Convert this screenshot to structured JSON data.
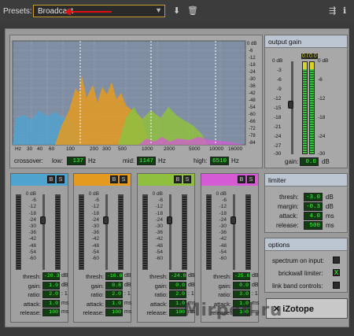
{
  "toolbar": {
    "presets_label": "Presets:",
    "preset_value": "Broadcast",
    "save_icon": "save-icon",
    "delete_icon": "trash-icon",
    "route_icon": "routing-icon",
    "info_icon": "info-icon"
  },
  "spectrum": {
    "freq_labels": [
      "Hz",
      "30",
      "40",
      "60",
      "100",
      "200",
      "300",
      "500",
      "1000",
      "2000",
      "5000",
      "10000",
      "16000"
    ],
    "db_labels": [
      "0 dB",
      "-6",
      "-12",
      "-18",
      "-24",
      "-30",
      "-36",
      "-42",
      "-48",
      "-54",
      "-60",
      "-66",
      "-72",
      "-78",
      "-84"
    ],
    "crossover_label": "crossover:",
    "low_label": "low:",
    "low_value": "137",
    "mid_label": "mid:",
    "mid_value": "1147",
    "high_label": "high:",
    "high_value": "6510",
    "hz_unit": "Hz"
  },
  "band_scale": [
    "0 dB",
    "-6",
    "-12",
    "-18",
    "-24",
    "-30",
    "-36",
    "-42",
    "-48",
    "-54",
    "-60"
  ],
  "bands": [
    {
      "color": "#4fa3cf",
      "thresh": "-20.3",
      "gain": "1.0",
      "ratio": "2.0",
      "attack": "1.0",
      "release": "100"
    },
    {
      "color": "#e49a1f",
      "thresh": "-16.6",
      "gain": "0.8",
      "ratio": "2.0",
      "attack": "1.0",
      "release": "100"
    },
    {
      "color": "#8fbf3f",
      "thresh": "-24.8",
      "gain": "0.0",
      "ratio": "2.0",
      "attack": "1.0",
      "release": "100"
    },
    {
      "color": "#d45bd4",
      "thresh": "-25.6",
      "gain": "0.0",
      "ratio": "3.0",
      "attack": "1.0",
      "release": "100"
    }
  ],
  "band_labels": {
    "thresh": "thresh:",
    "gain": "gain:",
    "ratio": "ratio:",
    "attack": "attack:",
    "release": "release:",
    "thresh_unit": "dB",
    "gain_unit": "dB",
    "ratio_unit": ": 1",
    "attack_unit": "ms",
    "release_unit": "ms"
  },
  "output": {
    "title": "output gain",
    "peak_left": "0.0",
    "peak_right": "0.0",
    "scale": [
      "0 dB",
      "-3",
      "-6",
      "-9",
      "-12",
      "-15",
      "-18",
      "-21",
      "-24",
      "-27",
      "-30"
    ],
    "gain_label": "gain:",
    "gain_value": "0.0",
    "gain_unit": "dB"
  },
  "limiter": {
    "title": "limiter",
    "thresh_label": "thresh:",
    "thresh_value": "-3.0",
    "thresh_unit": "dB",
    "margin_label": "margin:",
    "margin_value": "-0.3",
    "margin_unit": "dB",
    "attack_label": "attack:",
    "attack_value": "4.0",
    "attack_unit": "ms",
    "release_label": "release:",
    "release_value": "500",
    "release_unit": "ms"
  },
  "options": {
    "title": "options",
    "spectrum_label": "spectrum on input:",
    "spectrum_checked": false,
    "brickwall_label": "brickwall limiter:",
    "brickwall_checked": true,
    "brickwall_mark": "X",
    "link_label": "link band controls:",
    "link_checked": false
  },
  "brand": {
    "logo_text": "iZotope",
    "watermark": "Mirped.ru"
  }
}
